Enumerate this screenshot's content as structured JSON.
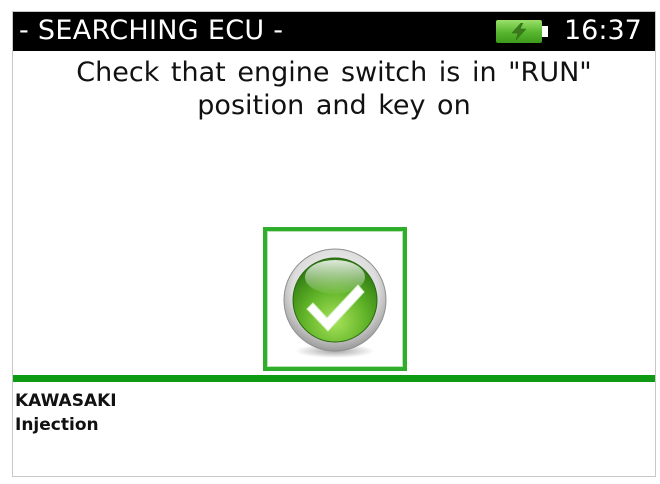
{
  "header": {
    "title": "- SEARCHING ECU -",
    "time": "16:37",
    "battery_icon": "battery-charging-icon",
    "battery_color": "#56b52d",
    "background_color": "#000000"
  },
  "message": {
    "text": "Check that engine switch is in \"RUN\"\nposition and key on"
  },
  "confirm": {
    "icon": "checkmark-icon",
    "accent_color": "#2fae2c"
  },
  "info": {
    "brand": "KAWASAKI",
    "system": "Injection"
  },
  "divider_color": "#0e9a12"
}
